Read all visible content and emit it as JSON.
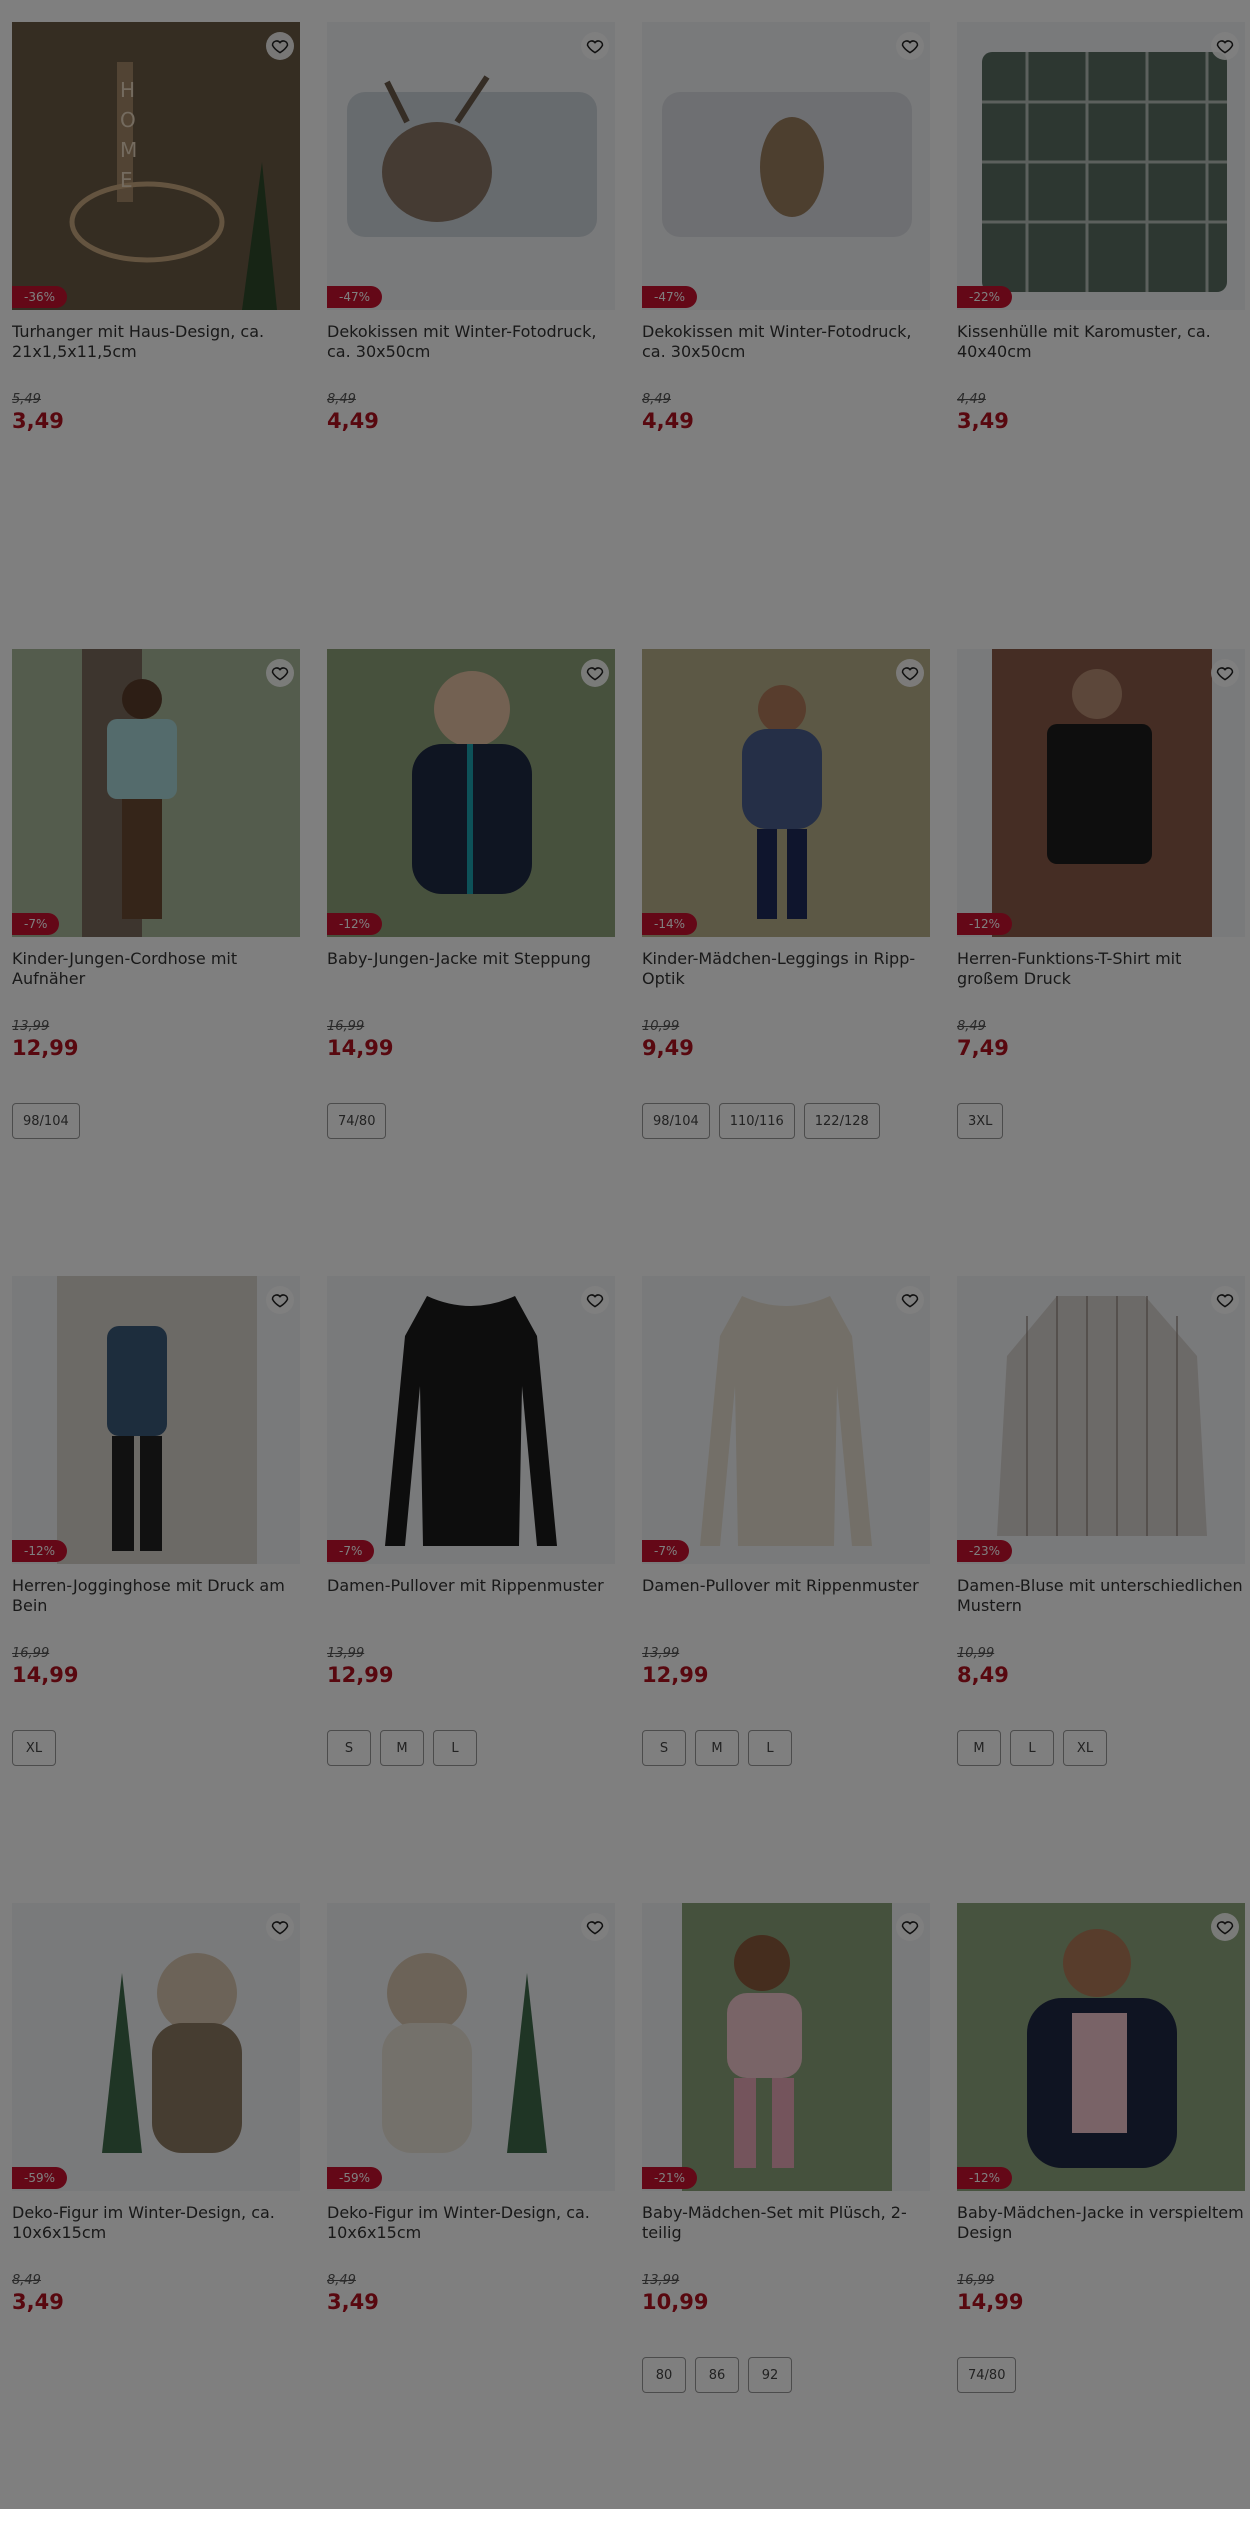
{
  "colors": {
    "accent": "#b0101e",
    "badge": "#c8102e",
    "overlay": "rgba(0,0,0,0.5)"
  },
  "products": [
    {
      "title": "Turhanger mit Haus-Design, ca. 21x1,5x11,5cm",
      "discount": "-36%",
      "old_price": "5,49",
      "price": "3,49",
      "sizes": [],
      "image": "home-sign"
    },
    {
      "title": "Dekokissen mit Winter-Fotodruck, ca. 30x50cm",
      "discount": "-47%",
      "old_price": "8,49",
      "price": "4,49",
      "sizes": [],
      "image": "deer-pillow"
    },
    {
      "title": "Dekokissen mit Winter-Fotodruck, ca. 30x50cm",
      "discount": "-47%",
      "old_price": "8,49",
      "price": "4,49",
      "sizes": [],
      "image": "owl-pillow"
    },
    {
      "title": "Kissenhülle mit Karomuster, ca. 40x40cm",
      "discount": "-22%",
      "old_price": "4,49",
      "price": "3,49",
      "sizes": [],
      "image": "plaid-pillow"
    },
    {
      "title": "Kinder-Jungen-Cordhose mit Aufnäher",
      "discount": "-7%",
      "old_price": "13,99",
      "price": "12,99",
      "sizes": [
        "98/104"
      ],
      "image": "boy-tree"
    },
    {
      "title": "Baby-Jungen-Jacke mit Steppung",
      "discount": "-12%",
      "old_price": "16,99",
      "price": "14,99",
      "sizes": [
        "74/80"
      ],
      "image": "baby-jacket"
    },
    {
      "title": "Kinder-Mädchen-Leggings in Ripp-Optik",
      "discount": "-14%",
      "old_price": "10,99",
      "price": "9,49",
      "sizes": [
        "98/104",
        "110/116",
        "122/128"
      ],
      "image": "girl-field"
    },
    {
      "title": "Herren-Funktions-T-Shirt mit großem Druck",
      "discount": "-12%",
      "old_price": "8,49",
      "price": "7,49",
      "sizes": [
        "3XL"
      ],
      "image": "man-tshirt"
    },
    {
      "title": "Herren-Jogginghose mit Druck am Bein",
      "discount": "-12%",
      "old_price": "16,99",
      "price": "14,99",
      "sizes": [
        "XL"
      ],
      "image": "man-jogging"
    },
    {
      "title": "Damen-Pullover mit Rippenmuster",
      "discount": "-7%",
      "old_price": "13,99",
      "price": "12,99",
      "sizes": [
        "S",
        "M",
        "L"
      ],
      "image": "black-pullover"
    },
    {
      "title": "Damen-Pullover mit Rippenmuster",
      "discount": "-7%",
      "old_price": "13,99",
      "price": "12,99",
      "sizes": [
        "S",
        "M",
        "L"
      ],
      "image": "cream-pullover"
    },
    {
      "title": "Damen-Bluse mit unterschiedlichen Mustern",
      "discount": "-23%",
      "old_price": "10,99",
      "price": "8,49",
      "sizes": [
        "M",
        "L",
        "XL"
      ],
      "image": "striped-blouse"
    },
    {
      "title": "Deko-Figur im Winter-Design, ca. 10x6x15cm",
      "discount": "-59%",
      "old_price": "8,49",
      "price": "3,49",
      "sizes": [],
      "image": "figure-girl"
    },
    {
      "title": "Deko-Figur im Winter-Design, ca. 10x6x15cm",
      "discount": "-59%",
      "old_price": "8,49",
      "price": "3,49",
      "sizes": [],
      "image": "figure-reindeer"
    },
    {
      "title": "Baby-Mädchen-Set mit Plüsch, 2-teilig",
      "discount": "-21%",
      "old_price": "13,99",
      "price": "10,99",
      "sizes": [
        "80",
        "86",
        "92"
      ],
      "image": "baby-pink-set"
    },
    {
      "title": "Baby-Mädchen-Jacke in verspieltem Design",
      "discount": "-12%",
      "old_price": "16,99",
      "price": "14,99",
      "sizes": [
        "74/80"
      ],
      "image": "baby-floral-jacket"
    }
  ]
}
